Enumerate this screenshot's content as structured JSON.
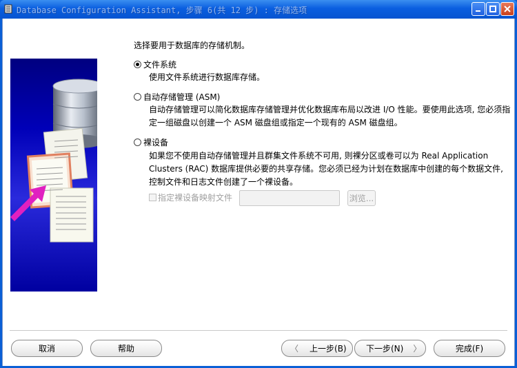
{
  "window": {
    "title": "Database Configuration Assistant, 步骤 6(共 12 步) : 存储选项"
  },
  "content": {
    "prompt": "选择要用于数据库的存储机制。",
    "options": [
      {
        "label": "文件系统",
        "checked": true,
        "description": [
          "使用文件系统进行数据库存储。"
        ]
      },
      {
        "label": "自动存储管理 (ASM)",
        "checked": false,
        "description": [
          "自动存储管理可以简化数据库存储管理并优化数据库布局以改进 I/O 性能。要使用此选项, 您必须指",
          "定一组磁盘以创建一个 ASM 磁盘组或指定一个现有的 ASM 磁盘组。"
        ]
      },
      {
        "label": "裸设备",
        "checked": false,
        "description": [
          "如果您不使用自动存储管理并且群集文件系统不可用, 则裸分区或卷可以为 Real Application",
          "Clusters (RAC) 数据库提供必要的共享存储。您必须已经为计划在数据库中创建的每个数据文件,",
          "控制文件和日志文件创建了一个裸设备。"
        ]
      }
    ],
    "raw_mapping_checkbox_label": "指定裸设备映射文件",
    "raw_mapping_path_value": "",
    "browse_label": "浏览..."
  },
  "buttons": {
    "cancel": "取消",
    "help": "帮助",
    "back": "上一步(B)",
    "next": "下一步(N)",
    "finish": "完成(F)"
  },
  "colors": {
    "titlebar": "#0a5ee0",
    "banner": "#0000b8",
    "disabled_text": "#a0a0a0"
  }
}
